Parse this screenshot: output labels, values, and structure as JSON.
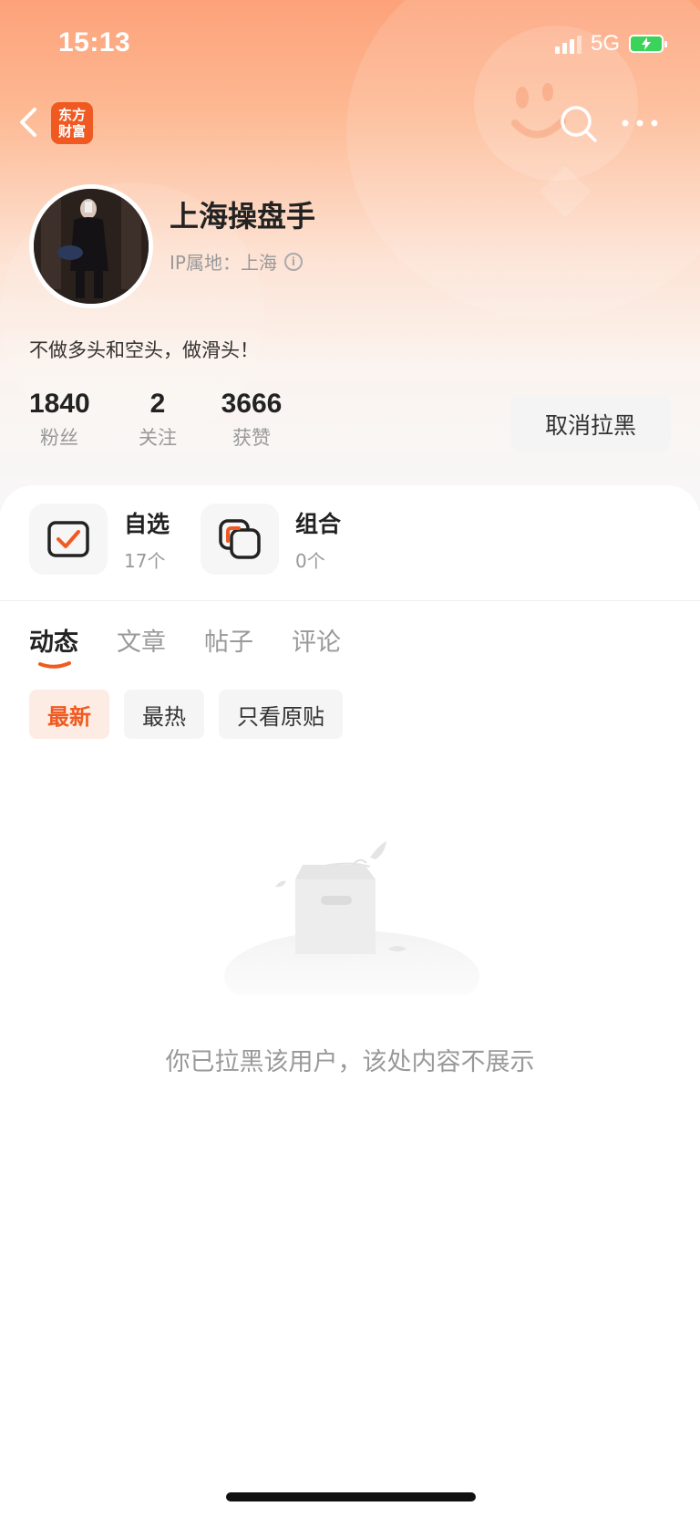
{
  "status_bar": {
    "time": "15:13",
    "network": "5G"
  },
  "nav": {
    "logo_line1": "东方",
    "logo_line2": "财富"
  },
  "profile": {
    "username": "上海操盘手",
    "ip_label": "IP属地：上海",
    "bio": "不做多头和空头，做滑头！",
    "stats": [
      {
        "value": "1840",
        "label": "粉丝"
      },
      {
        "value": "2",
        "label": "关注"
      },
      {
        "value": "3666",
        "label": "获赞"
      }
    ],
    "unblock_label": "取消拉黑"
  },
  "quick_entries": [
    {
      "title": "自选",
      "count": "17个"
    },
    {
      "title": "组合",
      "count": "0个"
    }
  ],
  "tabs": [
    "动态",
    "文章",
    "帖子",
    "评论"
  ],
  "filters": [
    "最新",
    "最热",
    "只看原贴"
  ],
  "empty_message": "你已拉黑该用户，该处内容不展示",
  "colors": {
    "accent": "#f05a22",
    "header_gradient_top": "#fda27a"
  },
  "icons": [
    "back-icon",
    "search-icon",
    "more-icon",
    "info-icon",
    "watchlist-icon",
    "portfolio-icon",
    "empty-box-illustration"
  ]
}
